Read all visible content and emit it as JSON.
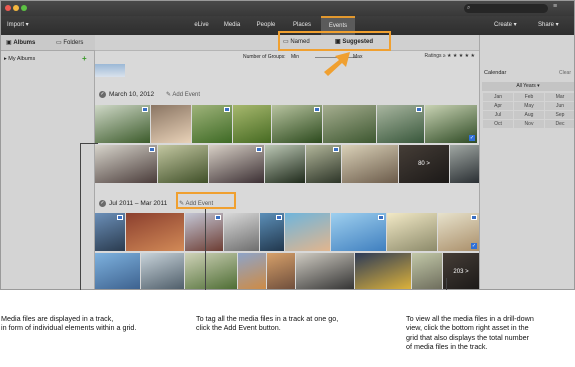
{
  "menubar": {
    "import": "Import",
    "tabs": [
      "eLive",
      "Media",
      "People",
      "Places",
      "Events"
    ],
    "create": "Create",
    "share": "Share"
  },
  "left_panel": {
    "albums_tab": "Albums",
    "folders_tab": "Folders",
    "my_albums": "My Albums"
  },
  "subbar": {
    "named": "Named",
    "suggested": "Suggested",
    "number_of_groups": "Number of Groups:",
    "min": "Min",
    "max": "Max",
    "ratings": "Ratings"
  },
  "events": [
    {
      "date": "March 10, 2012",
      "add_event": "Add Event"
    },
    {
      "date": "Jul 2011 – Mar 2011",
      "add_event": "Add Event",
      "more_label": "203 >"
    }
  ],
  "event1_more": "80 >",
  "calendar": {
    "title": "Calendar",
    "clear": "Clear",
    "all_years": "All Years",
    "months": [
      "Jan",
      "Feb",
      "Mar",
      "Apr",
      "May",
      "Jun",
      "Jul",
      "Aug",
      "Sep",
      "Oct",
      "Nov",
      "Dec"
    ]
  },
  "annotations": {
    "left": "Media files are displayed in a track,\nin form of individual elements within a grid.",
    "middle": "To tag all the media files in a track at one go,\nclick the Add Event button.",
    "right": "To view all the media files in a drill-down\nview, click the bottom right asset in the\ngrid that also displays the total number\nof media files in the track."
  },
  "colors": {
    "accent": "#e2982e",
    "callout": "#f0a030"
  }
}
